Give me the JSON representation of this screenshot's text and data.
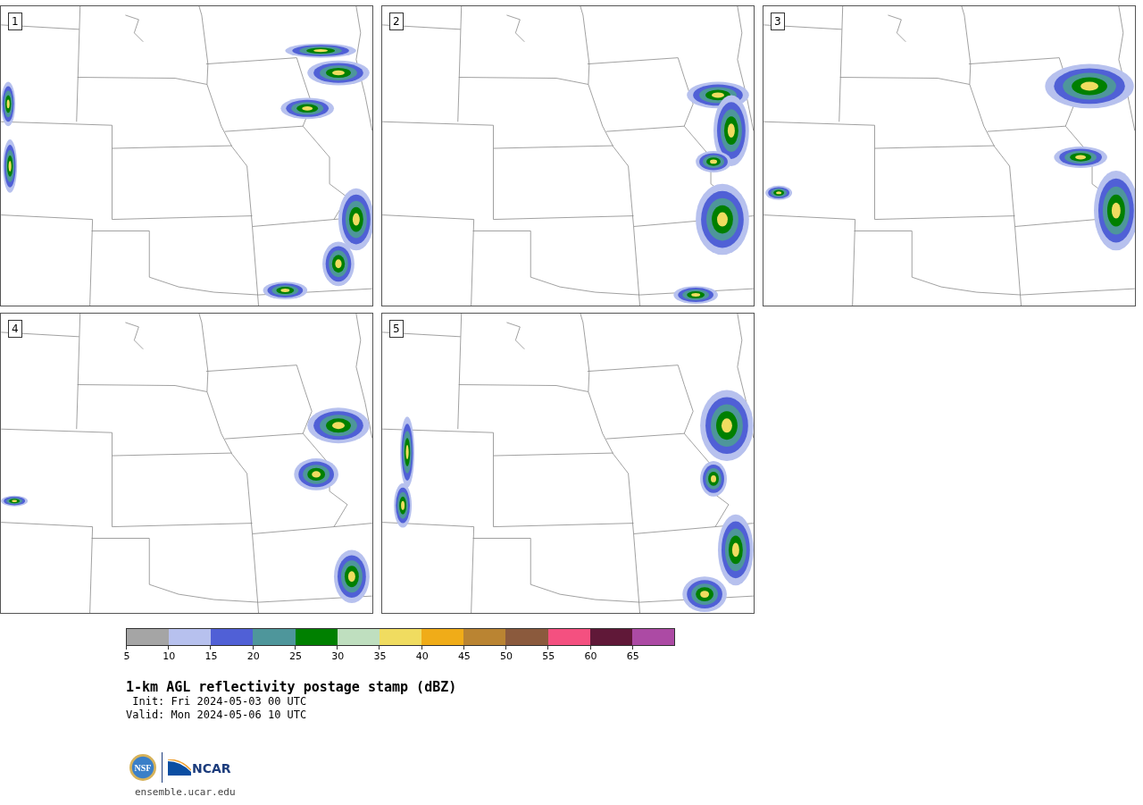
{
  "panels": [
    {
      "label": "1"
    },
    {
      "label": "2"
    },
    {
      "label": "3"
    },
    {
      "label": "4"
    },
    {
      "label": "5"
    }
  ],
  "colorbar": {
    "segments": [
      {
        "color": "#a5a5a5"
      },
      {
        "color": "#b7c1ee"
      },
      {
        "color": "#5060d6"
      },
      {
        "color": "#4e969b"
      },
      {
        "color": "#008000"
      },
      {
        "color": "#bfdfbf"
      },
      {
        "color": "#f0dc60"
      },
      {
        "color": "#f0ac18"
      },
      {
        "color": "#ba8432"
      },
      {
        "color": "#8b5a3d"
      },
      {
        "color": "#f45080"
      },
      {
        "color": "#601838"
      },
      {
        "color": "#ac4aa4"
      }
    ],
    "ticks": [
      "5",
      "10",
      "15",
      "20",
      "25",
      "30",
      "35",
      "40",
      "45",
      "50",
      "55",
      "60",
      "65"
    ]
  },
  "title": "1-km AGL reflectivity postage stamp (dBZ)",
  "init": " Init: Fri 2024-05-03 00 UTC",
  "valid": "Valid: Mon 2024-05-06 10 UTC",
  "logos": {
    "nsf": "NSF",
    "ncar": "NCAR"
  },
  "footer": "ensemble.ucar.edu"
}
